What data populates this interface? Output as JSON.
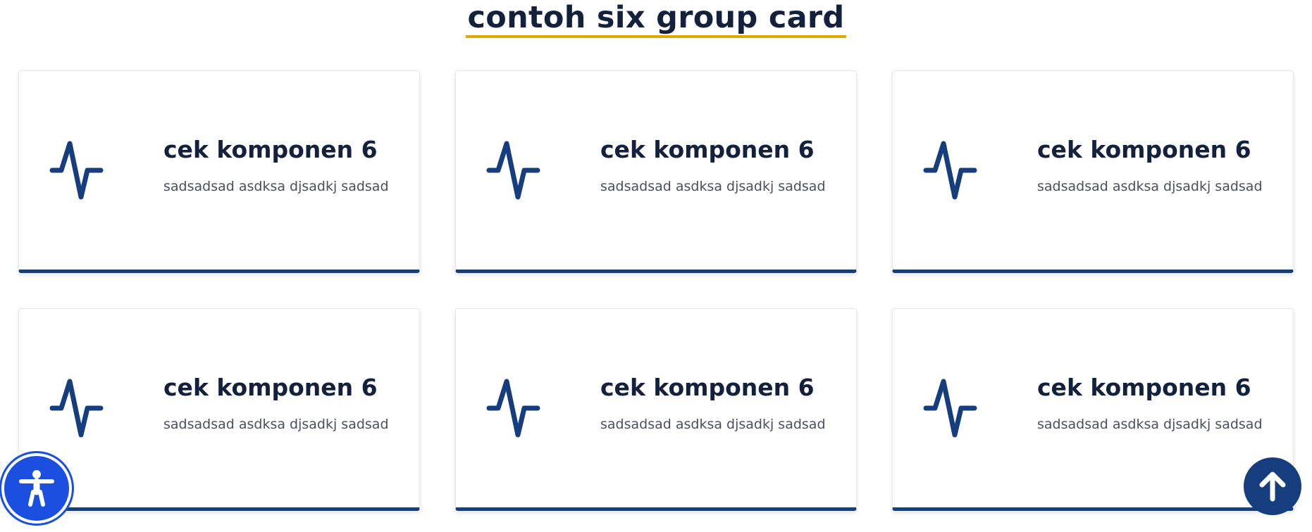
{
  "section": {
    "title": "contoh six group card"
  },
  "cards": [
    {
      "title": "cek komponen 6",
      "description": "sadsadsad asdksa djsadkj sadsad",
      "icon": "activity-icon"
    },
    {
      "title": "cek komponen 6",
      "description": "sadsadsad asdksa djsadkj sadsad",
      "icon": "activity-icon"
    },
    {
      "title": "cek komponen 6",
      "description": "sadsadsad asdksa djsadkj sadsad",
      "icon": "activity-icon"
    },
    {
      "title": "cek komponen 6",
      "description": "sadsadsad asdksa djsadkj sadsad",
      "icon": "activity-icon"
    },
    {
      "title": "cek komponen 6",
      "description": "sadsadsad asdksa djsadkj sadsad",
      "icon": "activity-icon"
    },
    {
      "title": "cek komponen 6",
      "description": "sadsadsad asdksa djsadkj sadsad",
      "icon": "activity-icon"
    }
  ],
  "floating": {
    "accessibility_icon": "accessibility-icon",
    "back_to_top_icon": "arrow-up-icon"
  },
  "colors": {
    "title_text": "#14213d",
    "title_underline": "#e0a800",
    "card_accent": "#163d7d",
    "icon_stroke": "#163d7d",
    "accessibility_bg": "#1a4fe0",
    "back_to_top_bg": "#163d7d"
  }
}
